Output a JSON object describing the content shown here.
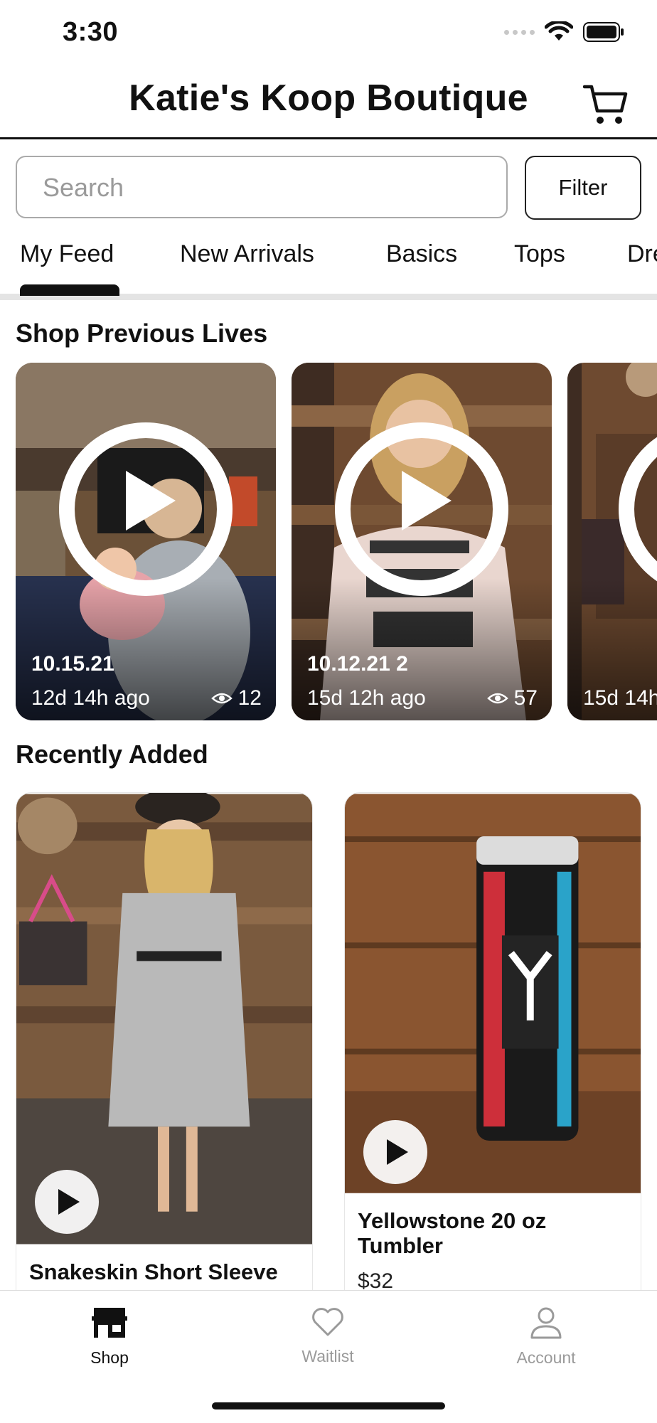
{
  "status_bar": {
    "time": "3:30"
  },
  "header": {
    "title": "Katie's Koop Boutique"
  },
  "search": {
    "placeholder": "Search",
    "filter_label": "Filter"
  },
  "tabs": [
    {
      "label": "My Feed",
      "active": true
    },
    {
      "label": "New Arrivals",
      "active": false
    },
    {
      "label": "Basics",
      "active": false
    },
    {
      "label": "Tops",
      "active": false
    },
    {
      "label": "Dre",
      "active": false
    }
  ],
  "lives_section": {
    "title": "Shop Previous Lives",
    "items": [
      {
        "title": "10.15.21",
        "ago": "12d 14h ago",
        "views": "12"
      },
      {
        "title": "10.12.21 2",
        "ago": "15d 12h ago",
        "views": "57"
      },
      {
        "title": "",
        "ago": "15d 14h",
        "views": ""
      }
    ]
  },
  "recent_section": {
    "title": "Recently Added",
    "items": [
      {
        "name": "Snakeskin Short Sleeve",
        "price": ""
      },
      {
        "name": "Yellowstone 20 oz Tumbler",
        "price": "$32"
      }
    ]
  },
  "bottom_nav": [
    {
      "label": "Shop",
      "icon": "store-icon",
      "active": true
    },
    {
      "label": "Waitlist",
      "icon": "heart-icon",
      "active": false
    },
    {
      "label": "Account",
      "icon": "user-icon",
      "active": false
    }
  ],
  "colors": {
    "text": "#111111",
    "inactive": "#9a9a9a",
    "divider": "#e4e4e4"
  }
}
